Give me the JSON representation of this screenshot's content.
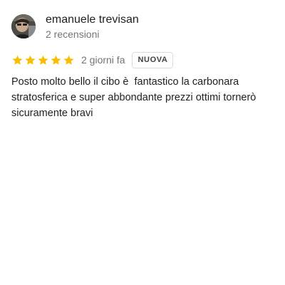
{
  "reviewer": {
    "name": "emanuele trevisan",
    "meta": "2 recensioni"
  },
  "rating": {
    "stars": 5,
    "max": 5,
    "color": "#fbbc04",
    "date": "2 giorni fa",
    "badge": "NUOVA"
  },
  "review": {
    "text": "Posto molto bello il cibo è  fantastico la carbonara stratosferica e super abbondante prezzi ottimi tornerò sicuramente bravi"
  },
  "icons": {
    "star": "star-icon",
    "avatar": "profile-photo"
  }
}
